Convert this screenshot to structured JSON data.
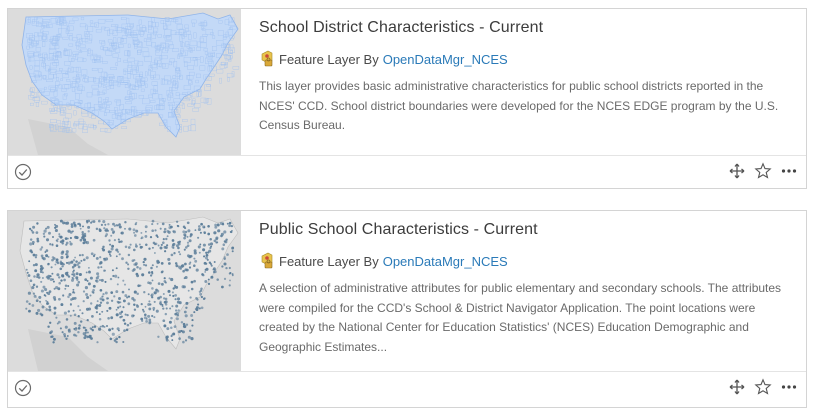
{
  "cards": [
    {
      "title": "School District Characteristics - Current",
      "type_label": "Feature Layer By",
      "owner": "OpenDataMgr_NCES",
      "description": "This layer provides basic administrative characteristics for public school districts reported in the NCES' CCD. School district boundaries were developed for the NCES EDGE program by the U.S. Census Bureau.",
      "thumbnail": "us-school-district-boundaries-map",
      "icons": [
        "check-circle-icon",
        "move-icon",
        "star-icon",
        "more-icon"
      ]
    },
    {
      "title": "Public School Characteristics - Current",
      "type_label": "Feature Layer By",
      "owner": "OpenDataMgr_NCES",
      "description": "A selection of administrative attributes for public elementary and secondary schools. The attributes were compiled for the CCD's School & District Navigator Application. The point locations were created by the National Center for Education Statistics' (NCES) Education Demographic and Geographic Estimates...",
      "thumbnail": "us-public-school-points-map",
      "icons": [
        "check-circle-icon",
        "move-icon",
        "star-icon",
        "more-icon"
      ]
    }
  ],
  "colors": {
    "title": "#3c3c3c",
    "owner_link": "#2a7ab8",
    "description": "#6a6a6a",
    "district_fill": "#a9c8f2",
    "school_points": "#5b7d99",
    "map_background": "#dcdcdc"
  }
}
